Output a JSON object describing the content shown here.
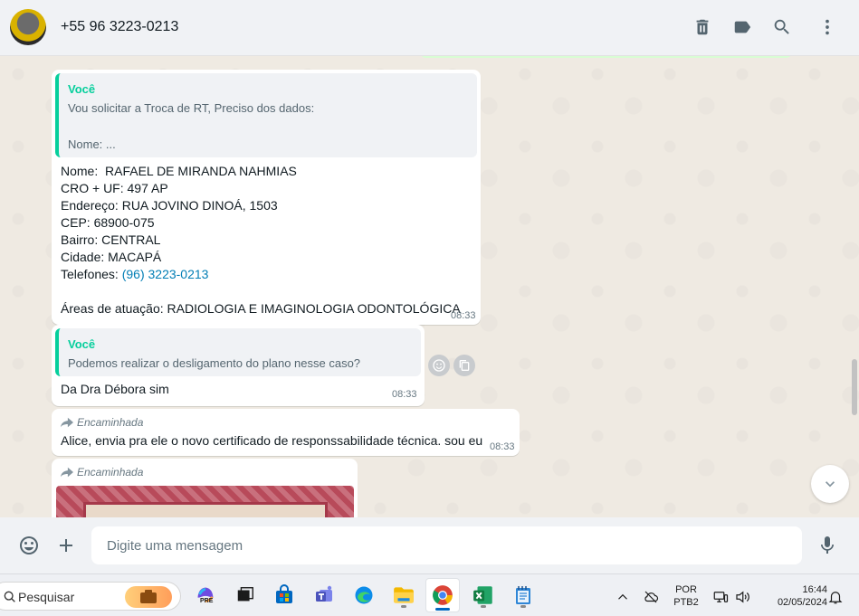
{
  "header": {
    "contact_name": "+55 96 3223-0213"
  },
  "messages": [
    {
      "quote_author": "Você",
      "quote_line1": "Vou solicitar a Troca de RT, Preciso dos dados:",
      "quote_line2": "Nome:  ...",
      "lines": [
        "Nome:  RAFAEL DE MIRANDA NAHMIAS",
        "CRO + UF: 497 AP",
        "Endereço: RUA JOVINO DINOÁ, 1503",
        "CEP: 68900-075",
        "Bairro: CENTRAL",
        "Cidade: MACAPÁ"
      ],
      "phone_label": "Telefones: ",
      "phone_link": "(96) 3223-0213",
      "last_line": "Áreas de atuação: RADIOLOGIA E IMAGINOLOGIA ODONTOLÓGICA",
      "time": "08:33"
    },
    {
      "quote_author": "Você",
      "quote_line1": "Podemos realizar o desligamento do plano nesse caso?",
      "text": "Da Dra Débora sim",
      "time": "08:33"
    },
    {
      "forwarded_label": "Encaminhada",
      "text": "Alice, envia pra ele o novo certificado de responssabilidade técnica. sou eu",
      "time": "08:33"
    },
    {
      "forwarded_label": "Encaminhada"
    }
  ],
  "composer": {
    "placeholder": "Digite uma mensagem"
  },
  "taskbar": {
    "search_label": "Pesquisar",
    "copilot_badge": "PRE",
    "language_line1": "POR",
    "language_line2": "PTB2",
    "clock_time": "16:44",
    "clock_date": "02/05/2024"
  }
}
